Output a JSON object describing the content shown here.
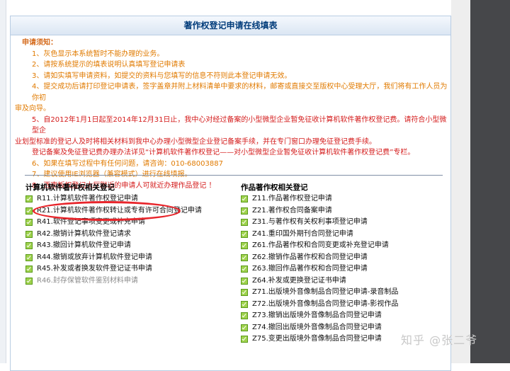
{
  "title": "著作权登记申请在线填表",
  "notice": {
    "heading": "申请须知：",
    "n1": "1、灰色显示本系统暂时不能办理的业务。",
    "n2": "2、请按系统提示的填表说明认真填写登记申请表",
    "n3": "3、请如实填写申请资料，如提交的资料与您填写的信息不符则此本登记申请无效。",
    "n4a": "4、提交成功后请打印登记申请表，签字盖章并附上材料清单中要求的材料，邮寄或直接交至版权中心受理大厅，我们将有工作人员为你初",
    "n4b": "审及向导。",
    "n5a": "5、自2012年1月1日起至2014年12月31日止，我中心对经过备案的小型微型企业暂免征收计算机软件著作权登记费。请符合小型微型企",
    "n5b": "业划型标准的登记人及时将相关材料到我中心办理小型微型企业登记备案手续，并在专门窗口办理免征登记费手续。",
    "n5c": "登记备案及免征登记费办理办法详见“计算机软件著作权登记——对小型微型企业暂免征收计算机软件著作权登记费”专栏。",
    "n6": "6、如果在填写过程中有任何问题，请咨询：010-68003887",
    "n7": "7、建议使用IE浏览器（兼容模式）进行在线填报。",
    "n8": "8、西南板权登记大厅附近的申请人可就近办理作品登记 ！"
  },
  "software": {
    "header": "计算机软件著作权相关登记",
    "items": [
      {
        "label": "R11.计算机软件著作权登记申请",
        "enabled": true
      },
      {
        "label": "R21.计算机软件著作权转让或专有许可合同登记申请",
        "enabled": true
      },
      {
        "label": "R41.软件登记事项变更或补充申请",
        "enabled": true
      },
      {
        "label": "R42.撤销计算机软件登记请求",
        "enabled": true
      },
      {
        "label": "R43.撤回计算机软件登记申请",
        "enabled": true
      },
      {
        "label": "R44.撤销或放弃计算机软件登记申请",
        "enabled": true
      },
      {
        "label": "R45.补发或者换发软件登记证书申请",
        "enabled": true
      },
      {
        "label": "R46.封存保管软件鉴别材料申请",
        "enabled": false
      }
    ]
  },
  "works": {
    "header": "作品著作权相关登记",
    "items": [
      {
        "label": "Z11.作品著作权登记申请"
      },
      {
        "label": "Z21.著作权合同备案申请"
      },
      {
        "label": "Z31.与著作权有关权利事项登记申请"
      },
      {
        "label": "Z41.重印国外期刊合同登记申请"
      },
      {
        "label": "Z61.作品著作权和合同变更或补充登记申请"
      },
      {
        "label": "Z62.撤销作品著作权和合同登记申请"
      },
      {
        "label": "Z63.撤回作品著作权和合同登记申请"
      },
      {
        "label": "Z64.补发或更换登记证书申请"
      },
      {
        "label": "Z71.出版境外音像制品合同登记申请-录音制品"
      },
      {
        "label": "Z72.出版境外音像制品合同登记申请-影视作品"
      },
      {
        "label": "Z73.撤销出版境外音像制品合同登记申请"
      },
      {
        "label": "Z74.撤回出版境外音像制品合同登记申请"
      },
      {
        "label": "Z75.变更出版境外音像制品合同登记申请"
      }
    ]
  },
  "watermark": "知乎 @张二爷",
  "colors": {
    "notice": "#e07a00",
    "highlight": "#e8252b",
    "title": "#003b7a"
  }
}
